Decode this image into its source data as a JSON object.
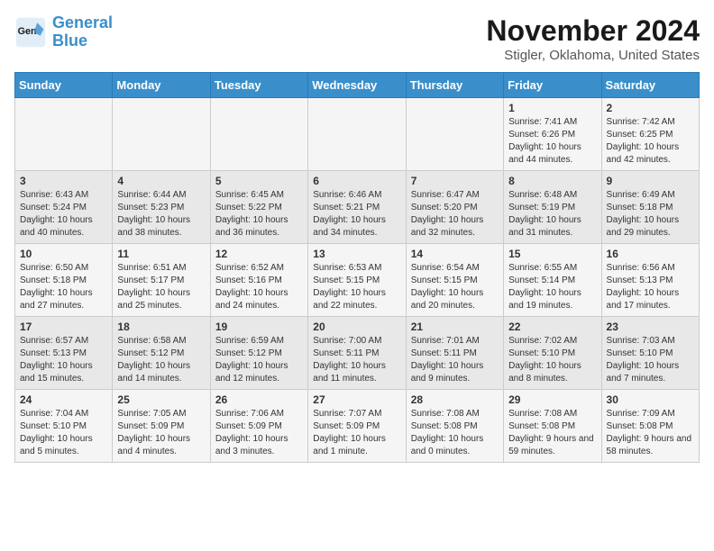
{
  "logo": {
    "line1": "General",
    "line2": "Blue"
  },
  "title": "November 2024",
  "subtitle": "Stigler, Oklahoma, United States",
  "weekdays": [
    "Sunday",
    "Monday",
    "Tuesday",
    "Wednesday",
    "Thursday",
    "Friday",
    "Saturday"
  ],
  "weeks": [
    [
      null,
      null,
      null,
      null,
      null,
      {
        "day": "1",
        "sunrise": "7:41 AM",
        "sunset": "6:26 PM",
        "daylight": "10 hours and 44 minutes."
      },
      {
        "day": "2",
        "sunrise": "7:42 AM",
        "sunset": "6:25 PM",
        "daylight": "10 hours and 42 minutes."
      }
    ],
    [
      {
        "day": "3",
        "sunrise": "6:43 AM",
        "sunset": "5:24 PM",
        "daylight": "10 hours and 40 minutes."
      },
      {
        "day": "4",
        "sunrise": "6:44 AM",
        "sunset": "5:23 PM",
        "daylight": "10 hours and 38 minutes."
      },
      {
        "day": "5",
        "sunrise": "6:45 AM",
        "sunset": "5:22 PM",
        "daylight": "10 hours and 36 minutes."
      },
      {
        "day": "6",
        "sunrise": "6:46 AM",
        "sunset": "5:21 PM",
        "daylight": "10 hours and 34 minutes."
      },
      {
        "day": "7",
        "sunrise": "6:47 AM",
        "sunset": "5:20 PM",
        "daylight": "10 hours and 32 minutes."
      },
      {
        "day": "8",
        "sunrise": "6:48 AM",
        "sunset": "5:19 PM",
        "daylight": "10 hours and 31 minutes."
      },
      {
        "day": "9",
        "sunrise": "6:49 AM",
        "sunset": "5:18 PM",
        "daylight": "10 hours and 29 minutes."
      }
    ],
    [
      {
        "day": "10",
        "sunrise": "6:50 AM",
        "sunset": "5:18 PM",
        "daylight": "10 hours and 27 minutes."
      },
      {
        "day": "11",
        "sunrise": "6:51 AM",
        "sunset": "5:17 PM",
        "daylight": "10 hours and 25 minutes."
      },
      {
        "day": "12",
        "sunrise": "6:52 AM",
        "sunset": "5:16 PM",
        "daylight": "10 hours and 24 minutes."
      },
      {
        "day": "13",
        "sunrise": "6:53 AM",
        "sunset": "5:15 PM",
        "daylight": "10 hours and 22 minutes."
      },
      {
        "day": "14",
        "sunrise": "6:54 AM",
        "sunset": "5:15 PM",
        "daylight": "10 hours and 20 minutes."
      },
      {
        "day": "15",
        "sunrise": "6:55 AM",
        "sunset": "5:14 PM",
        "daylight": "10 hours and 19 minutes."
      },
      {
        "day": "16",
        "sunrise": "6:56 AM",
        "sunset": "5:13 PM",
        "daylight": "10 hours and 17 minutes."
      }
    ],
    [
      {
        "day": "17",
        "sunrise": "6:57 AM",
        "sunset": "5:13 PM",
        "daylight": "10 hours and 15 minutes."
      },
      {
        "day": "18",
        "sunrise": "6:58 AM",
        "sunset": "5:12 PM",
        "daylight": "10 hours and 14 minutes."
      },
      {
        "day": "19",
        "sunrise": "6:59 AM",
        "sunset": "5:12 PM",
        "daylight": "10 hours and 12 minutes."
      },
      {
        "day": "20",
        "sunrise": "7:00 AM",
        "sunset": "5:11 PM",
        "daylight": "10 hours and 11 minutes."
      },
      {
        "day": "21",
        "sunrise": "7:01 AM",
        "sunset": "5:11 PM",
        "daylight": "10 hours and 9 minutes."
      },
      {
        "day": "22",
        "sunrise": "7:02 AM",
        "sunset": "5:10 PM",
        "daylight": "10 hours and 8 minutes."
      },
      {
        "day": "23",
        "sunrise": "7:03 AM",
        "sunset": "5:10 PM",
        "daylight": "10 hours and 7 minutes."
      }
    ],
    [
      {
        "day": "24",
        "sunrise": "7:04 AM",
        "sunset": "5:10 PM",
        "daylight": "10 hours and 5 minutes."
      },
      {
        "day": "25",
        "sunrise": "7:05 AM",
        "sunset": "5:09 PM",
        "daylight": "10 hours and 4 minutes."
      },
      {
        "day": "26",
        "sunrise": "7:06 AM",
        "sunset": "5:09 PM",
        "daylight": "10 hours and 3 minutes."
      },
      {
        "day": "27",
        "sunrise": "7:07 AM",
        "sunset": "5:09 PM",
        "daylight": "10 hours and 1 minute."
      },
      {
        "day": "28",
        "sunrise": "7:08 AM",
        "sunset": "5:08 PM",
        "daylight": "10 hours and 0 minutes."
      },
      {
        "day": "29",
        "sunrise": "7:08 AM",
        "sunset": "5:08 PM",
        "daylight": "9 hours and 59 minutes."
      },
      {
        "day": "30",
        "sunrise": "7:09 AM",
        "sunset": "5:08 PM",
        "daylight": "9 hours and 58 minutes."
      }
    ]
  ],
  "labels": {
    "sunrise": "Sunrise:",
    "sunset": "Sunset:",
    "daylight": "Daylight:"
  }
}
